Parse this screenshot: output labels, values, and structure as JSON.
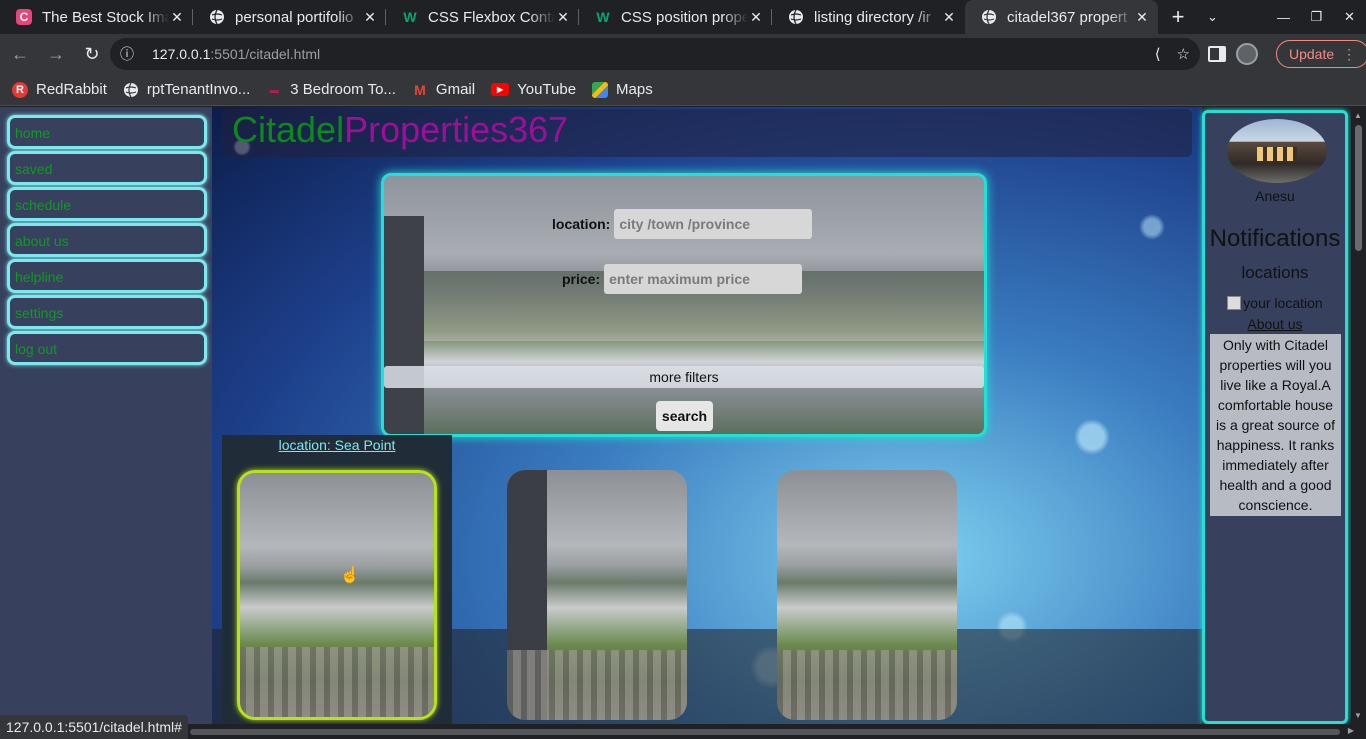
{
  "browser": {
    "tabs": [
      {
        "title": "The Best Stock Ima",
        "icon": "canva-icon",
        "color": "#e8457c"
      },
      {
        "title": "personal portifolio",
        "icon": "globe-icon",
        "color": "#e8eaed"
      },
      {
        "title": "CSS Flexbox Conta",
        "icon": "w3schools-icon",
        "color": "#04aa6d"
      },
      {
        "title": "CSS position prope",
        "icon": "w3schools-icon",
        "color": "#04aa6d"
      },
      {
        "title": "listing directory /ir",
        "icon": "globe-icon",
        "color": "#e8eaed"
      },
      {
        "title": "citadel367 propert",
        "icon": "globe-icon",
        "color": "#e8eaed",
        "active": true
      }
    ],
    "new_tab": "+",
    "url_host": "127.0.0.1",
    "url_rest": ":5501/citadel.html",
    "update_label": "Update",
    "bookmarks": [
      {
        "label": "RedRabbit",
        "icon": "redrabbit-icon",
        "color": "#e53935"
      },
      {
        "label": "rptTenantInvo...",
        "icon": "globe-icon",
        "color": "#e8eaed"
      },
      {
        "label": "3 Bedroom To...",
        "icon": "property-icon",
        "color": "#c2185b"
      },
      {
        "label": "Gmail",
        "icon": "gmail-icon",
        "color": "#ea4335"
      },
      {
        "label": "YouTube",
        "icon": "youtube-icon",
        "color": "#ff0000"
      },
      {
        "label": "Maps",
        "icon": "maps-icon",
        "color": "#34a853"
      }
    ],
    "status_url": "127.0.0.1:5501/citadel.html#"
  },
  "sidebar": {
    "items": [
      {
        "label": "home"
      },
      {
        "label": "saved"
      },
      {
        "label": "schedule"
      },
      {
        "label": "about us"
      },
      {
        "label": "helpline"
      },
      {
        "label": "settings"
      },
      {
        "label": "log out"
      }
    ]
  },
  "header": {
    "brand_part1": "Citadel",
    "brand_part2": "Properties367"
  },
  "search": {
    "location_label": "location:",
    "location_placeholder": "city /town /province",
    "price_label": "price:",
    "price_placeholder": "enter maximum price",
    "more_filters": "more filters",
    "search_button": "search"
  },
  "listing": {
    "location_link": "location: Sea Point"
  },
  "right_panel": {
    "user_name": "Anesu",
    "notifications": "Notifications",
    "locations": "locations",
    "location_img_alt": "your location",
    "about_link": "About us",
    "about_text": "Only with Citadel properties will you live like a Royal.A comfortable house is a great source of happiness. It ranks immediately after health and a good conscience."
  },
  "colors": {
    "brand_green": "#0b8a1b",
    "brand_purple": "#9f0d9a",
    "accent_cyan": "#22e0d5",
    "selected_yellow": "#b9e21b"
  }
}
